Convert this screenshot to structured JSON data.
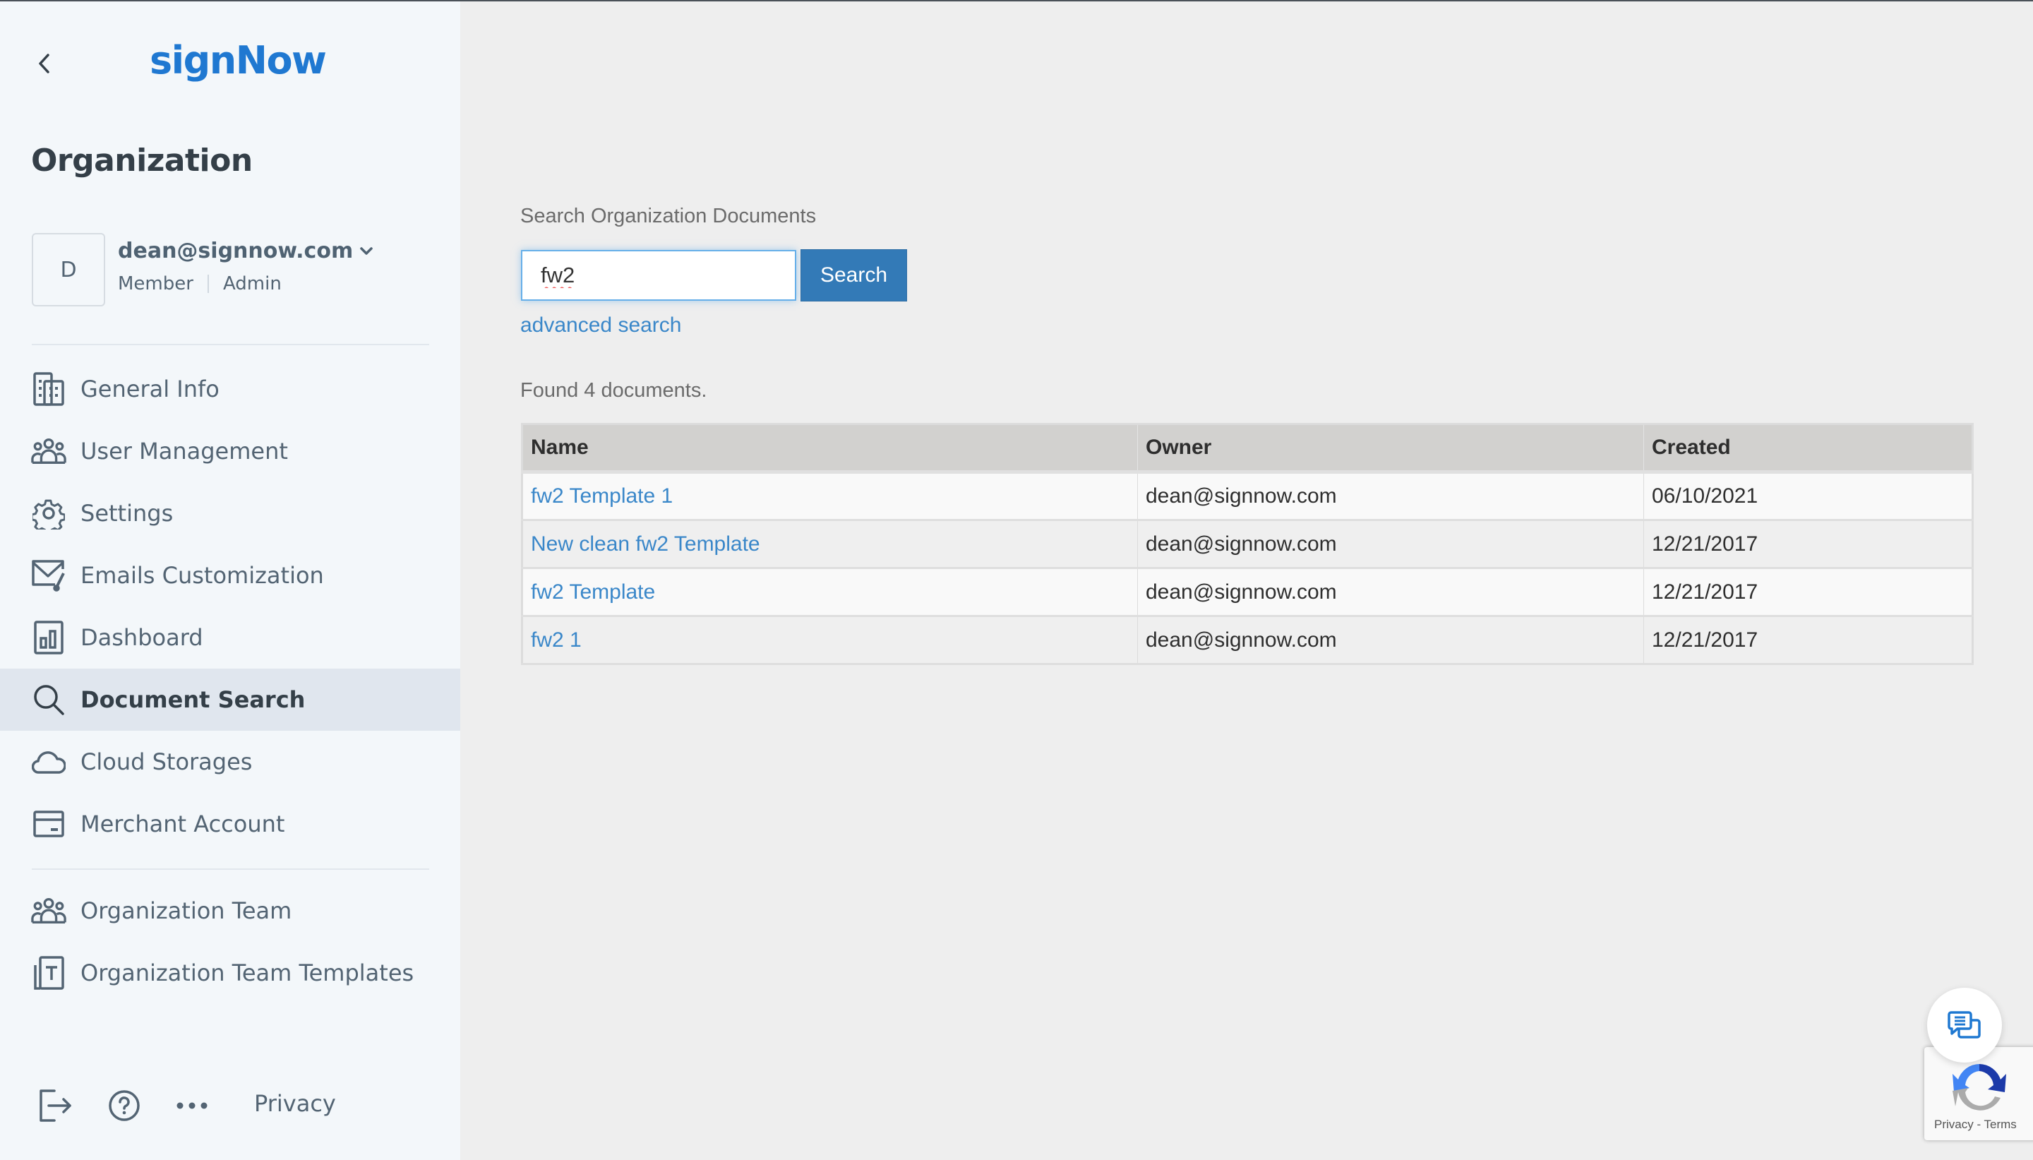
{
  "sidebar": {
    "back_icon": "chevron-left-icon",
    "logo": "signNow",
    "title": "Organization",
    "user": {
      "avatar_initial": "D",
      "email": "dean@signnow.com",
      "dropdown_icon": "chevron-down-icon",
      "roles": [
        "Member",
        "Admin"
      ]
    },
    "nav_items": [
      {
        "label": "General Info",
        "icon": "building-icon",
        "active": false
      },
      {
        "label": "User Management",
        "icon": "users-icon",
        "active": false
      },
      {
        "label": "Settings",
        "icon": "gear-icon",
        "active": false
      },
      {
        "label": "Emails Customization",
        "icon": "envelope-brush-icon",
        "active": false
      },
      {
        "label": "Dashboard",
        "icon": "bar-chart-icon",
        "active": false
      },
      {
        "label": "Document Search",
        "icon": "search-icon",
        "active": true
      },
      {
        "label": "Cloud Storages",
        "icon": "cloud-icon",
        "active": false
      },
      {
        "label": "Merchant Account",
        "icon": "credit-card-icon",
        "active": false
      }
    ],
    "team_items": [
      {
        "label": "Organization Team",
        "icon": "users-icon"
      },
      {
        "label": "Organization Team Templates",
        "icon": "template-icon"
      }
    ],
    "footer": {
      "logout_icon": "logout-icon",
      "help_icon": "help-circle-icon",
      "more_icon": "more-horizontal-icon",
      "privacy_label": "Privacy"
    }
  },
  "main": {
    "search_label": "Search Organization Documents",
    "search_value": "fw2",
    "search_button": "Search",
    "advanced_search": "advanced search",
    "result_summary": "Found 4 documents.",
    "table": {
      "columns": [
        "Name",
        "Owner",
        "Created"
      ],
      "rows": [
        {
          "name": "fw2 Template 1",
          "owner": "dean@signnow.com",
          "created": "06/10/2021"
        },
        {
          "name": "New clean fw2 Template",
          "owner": "dean@signnow.com",
          "created": "12/21/2017"
        },
        {
          "name": "fw2 Template",
          "owner": "dean@signnow.com",
          "created": "12/21/2017"
        },
        {
          "name": "fw2 1",
          "owner": "dean@signnow.com",
          "created": "12/21/2017"
        }
      ]
    }
  },
  "widgets": {
    "chat_icon": "chat-bubbles-icon",
    "recaptcha_terms": "Privacy - Terms"
  },
  "colors": {
    "brand": "#1f78d1",
    "link": "#3a87c9",
    "button": "#337ab7",
    "sidebar_bg": "#f3f7fa",
    "sidebar_active_bg": "#e0e6ee",
    "main_bg": "#eeeeee",
    "table_header_bg": "#d2d1cf"
  }
}
